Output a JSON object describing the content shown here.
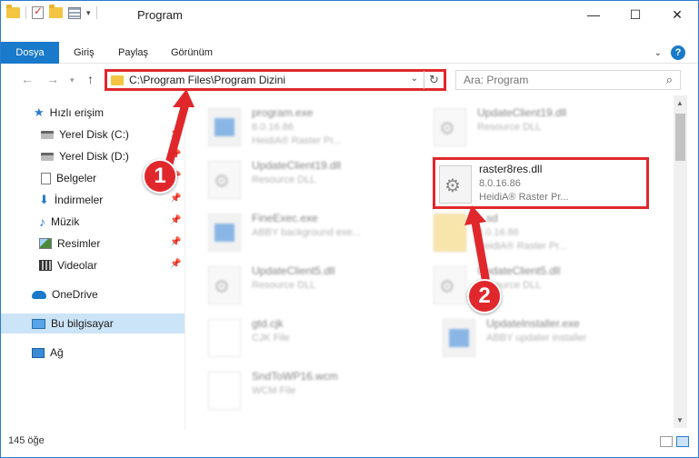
{
  "window": {
    "title": "Program",
    "controls": {
      "minimize": "—",
      "maximize": "☐",
      "close": "✕"
    }
  },
  "ribbon": {
    "tabs": [
      {
        "label": "Dosya",
        "active": true
      },
      {
        "label": "Giriş"
      },
      {
        "label": "Paylaş"
      },
      {
        "label": "Görünüm"
      }
    ],
    "help": "?"
  },
  "address": {
    "path": "C:\\Program Files\\Program Dizini",
    "search_placeholder": "Ara: Program"
  },
  "sidebar": {
    "items": [
      {
        "label": "Hızlı erişim",
        "icon": "star-icon"
      },
      {
        "label": "Yerel Disk (C:)",
        "icon": "drive-icon"
      },
      {
        "label": "Yerel Disk (D:)",
        "icon": "drive-icon"
      },
      {
        "label": "Belgeler",
        "icon": "document-icon"
      },
      {
        "label": "İndirmeler",
        "icon": "download-icon"
      },
      {
        "label": "Müzik",
        "icon": "music-icon"
      },
      {
        "label": "Resimler",
        "icon": "pictures-icon"
      },
      {
        "label": "Videolar",
        "icon": "video-icon"
      },
      {
        "label": "OneDrive",
        "icon": "cloud-icon"
      },
      {
        "label": "Bu bilgisayar",
        "icon": "computer-icon",
        "selected": true
      },
      {
        "label": "Ağ",
        "icon": "network-icon"
      }
    ]
  },
  "files": {
    "left": [
      {
        "name": "program.exe",
        "line1": "8.0.16.86",
        "line2": "HeidiA® Raster Pr...",
        "type": "exe"
      },
      {
        "name": "UpdateClient19.dll",
        "line1": "Resource DLL",
        "type": "dll"
      },
      {
        "name": "FineExec.exe",
        "line1": "ABBY background exe...",
        "type": "exe"
      },
      {
        "name": "UpdateClient5.dll",
        "line1": "Resource DLL",
        "type": "dll"
      },
      {
        "name": "gtd.cjk",
        "line1": "CJK File",
        "type": "blank"
      },
      {
        "name": "SndToWP16.wcm",
        "line1": "WCM File",
        "type": "blank"
      }
    ],
    "right": [
      {
        "name": "UpdateClient19.dll",
        "line1": "Resource DLL",
        "type": "dll"
      },
      {
        "name": "raster8res.dll",
        "line1": "8.0.16.86",
        "line2": "HeidiA® Raster Pr...",
        "type": "dll",
        "highlighted": true
      },
      {
        "name": "...sd",
        "line1": "8.0.16.86",
        "line2": "HeidiA® Raster Pr...",
        "type": "folder"
      },
      {
        "name": "UpdateClient5.dll",
        "line1": "Resource DLL",
        "type": "dll"
      },
      {
        "name": "UpdateInstaller.exe",
        "line1": "ABBY updater installer",
        "type": "exe"
      }
    ]
  },
  "status": {
    "item_count": "145 öğe"
  },
  "annotations": {
    "step1": "1",
    "step2": "2"
  },
  "colors": {
    "accent": "#1979ca",
    "highlight": "#e0282c"
  }
}
